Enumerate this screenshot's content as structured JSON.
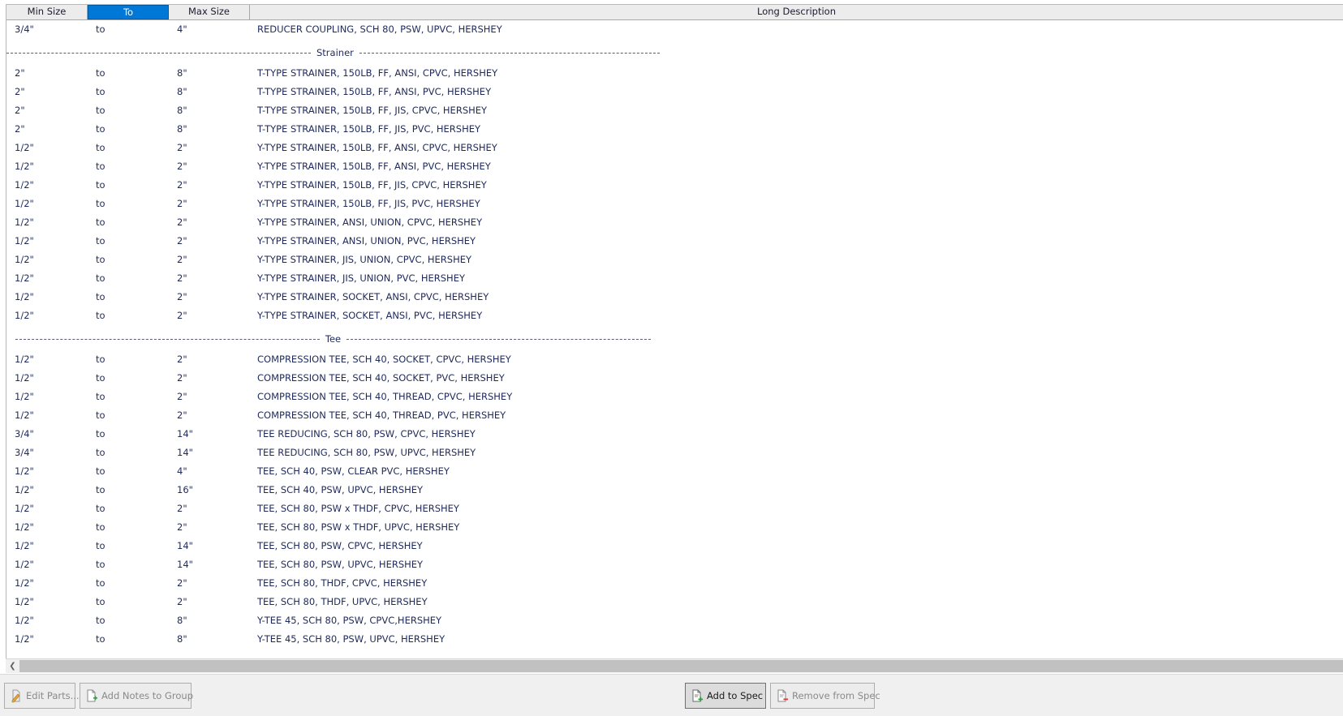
{
  "columns": {
    "min_size": "Min Size",
    "to": "To",
    "max_size": "Max Size",
    "long_description": "Long Description"
  },
  "selected_column": "to",
  "top_rows": [
    {
      "min": "3/4\"",
      "to": "to",
      "max": "4\"",
      "desc": "REDUCER COUPLING, SCH 80, PSW, UPVC, HERSHEY"
    }
  ],
  "groups": [
    {
      "title": "Strainer",
      "rows": [
        {
          "min": "2\"",
          "to": "to",
          "max": "8\"",
          "desc": "T-TYPE STRAINER, 150LB, FF, ANSI, CPVC, HERSHEY"
        },
        {
          "min": "2\"",
          "to": "to",
          "max": "8\"",
          "desc": "T-TYPE STRAINER, 150LB, FF, ANSI, PVC, HERSHEY"
        },
        {
          "min": "2\"",
          "to": "to",
          "max": "8\"",
          "desc": "T-TYPE STRAINER, 150LB, FF, JIS, CPVC, HERSHEY"
        },
        {
          "min": "2\"",
          "to": "to",
          "max": "8\"",
          "desc": "T-TYPE STRAINER, 150LB, FF, JIS, PVC, HERSHEY"
        },
        {
          "min": "1/2\"",
          "to": "to",
          "max": "2\"",
          "desc": "Y-TYPE STRAINER, 150LB, FF, ANSI, CPVC, HERSHEY"
        },
        {
          "min": "1/2\"",
          "to": "to",
          "max": "2\"",
          "desc": "Y-TYPE STRAINER, 150LB, FF, ANSI, PVC, HERSHEY"
        },
        {
          "min": "1/2\"",
          "to": "to",
          "max": "2\"",
          "desc": "Y-TYPE STRAINER, 150LB, FF, JIS, CPVC, HERSHEY"
        },
        {
          "min": "1/2\"",
          "to": "to",
          "max": "2\"",
          "desc": "Y-TYPE STRAINER, 150LB, FF, JIS, PVC, HERSHEY"
        },
        {
          "min": "1/2\"",
          "to": "to",
          "max": "2\"",
          "desc": "Y-TYPE STRAINER, ANSI, UNION, CPVC, HERSHEY"
        },
        {
          "min": "1/2\"",
          "to": "to",
          "max": "2\"",
          "desc": "Y-TYPE STRAINER, ANSI, UNION, PVC, HERSHEY"
        },
        {
          "min": "1/2\"",
          "to": "to",
          "max": "2\"",
          "desc": "Y-TYPE STRAINER, JIS, UNION, CPVC, HERSHEY"
        },
        {
          "min": "1/2\"",
          "to": "to",
          "max": "2\"",
          "desc": "Y-TYPE STRAINER, JIS, UNION, PVC, HERSHEY"
        },
        {
          "min": "1/2\"",
          "to": "to",
          "max": "2\"",
          "desc": "Y-TYPE STRAINER, SOCKET, ANSI, CPVC, HERSHEY"
        },
        {
          "min": "1/2\"",
          "to": "to",
          "max": "2\"",
          "desc": "Y-TYPE STRAINER, SOCKET, ANSI, PVC, HERSHEY"
        }
      ]
    },
    {
      "title": "Tee",
      "rows": [
        {
          "min": "1/2\"",
          "to": "to",
          "max": "2\"",
          "desc": "COMPRESSION TEE, SCH 40, SOCKET, CPVC, HERSHEY"
        },
        {
          "min": "1/2\"",
          "to": "to",
          "max": "2\"",
          "desc": "COMPRESSION TEE, SCH 40, SOCKET, PVC, HERSHEY"
        },
        {
          "min": "1/2\"",
          "to": "to",
          "max": "2\"",
          "desc": "COMPRESSION TEE, SCH 40, THREAD, CPVC, HERSHEY"
        },
        {
          "min": "1/2\"",
          "to": "to",
          "max": "2\"",
          "desc": "COMPRESSION TEE, SCH 40, THREAD, PVC, HERSHEY"
        },
        {
          "min": "3/4\"",
          "to": "to",
          "max": "14\"",
          "desc": "TEE REDUCING, SCH 80, PSW, CPVC, HERSHEY"
        },
        {
          "min": "3/4\"",
          "to": "to",
          "max": "14\"",
          "desc": "TEE REDUCING, SCH 80, PSW, UPVC, HERSHEY"
        },
        {
          "min": "1/2\"",
          "to": "to",
          "max": "4\"",
          "desc": "TEE, SCH 40, PSW, CLEAR PVC, HERSHEY"
        },
        {
          "min": "1/2\"",
          "to": "to",
          "max": "16\"",
          "desc": "TEE, SCH 40, PSW, UPVC, HERSHEY"
        },
        {
          "min": "1/2\"",
          "to": "to",
          "max": "2\"",
          "desc": "TEE, SCH 80, PSW x THDF, CPVC, HERSHEY"
        },
        {
          "min": "1/2\"",
          "to": "to",
          "max": "2\"",
          "desc": "TEE, SCH 80, PSW x THDF, UPVC, HERSHEY"
        },
        {
          "min": "1/2\"",
          "to": "to",
          "max": "14\"",
          "desc": "TEE, SCH 80, PSW, CPVC, HERSHEY"
        },
        {
          "min": "1/2\"",
          "to": "to",
          "max": "14\"",
          "desc": "TEE, SCH 80, PSW, UPVC, HERSHEY"
        },
        {
          "min": "1/2\"",
          "to": "to",
          "max": "2\"",
          "desc": "TEE, SCH 80, THDF, CPVC, HERSHEY"
        },
        {
          "min": "1/2\"",
          "to": "to",
          "max": "2\"",
          "desc": "TEE, SCH 80, THDF, UPVC, HERSHEY"
        },
        {
          "min": "1/2\"",
          "to": "to",
          "max": "8\"",
          "desc": "Y-TEE 45, SCH 80, PSW, CPVC,HERSHEY"
        },
        {
          "min": "1/2\"",
          "to": "to",
          "max": "8\"",
          "desc": "Y-TEE 45, SCH 80, PSW, UPVC, HERSHEY"
        }
      ]
    }
  ],
  "toolbar": {
    "edit_parts": "Edit Parts...",
    "add_notes": "Add Notes to Group",
    "add_to_spec": "Add to Spec",
    "remove_from_spec": "Remove from Spec"
  },
  "scroll": {
    "left_arrow_icon": "chevron-left-icon"
  },
  "colors": {
    "selected_header": "#0078d7",
    "row_text": "#1f2a5a",
    "add_icon_accent": "#2e9e3e",
    "remove_icon_accent": "#d33a3a"
  }
}
